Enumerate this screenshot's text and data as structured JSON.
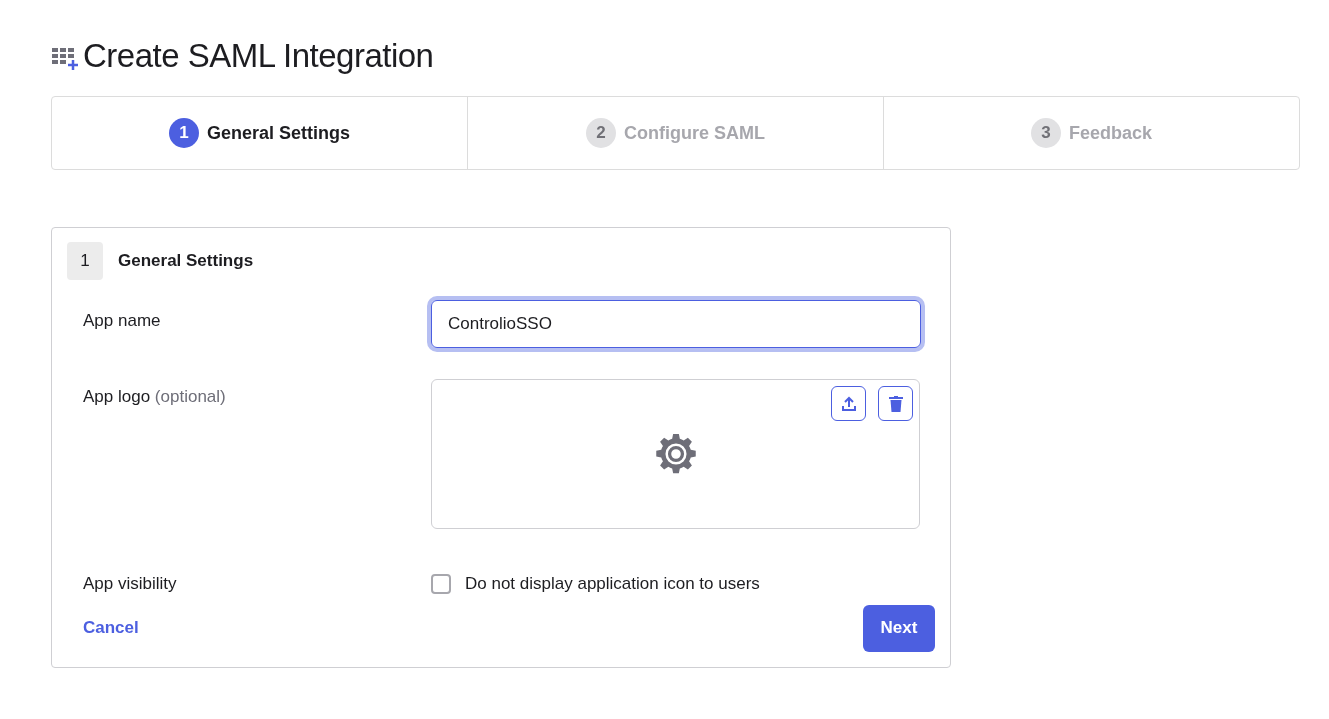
{
  "title": "Create SAML Integration",
  "steps": [
    {
      "number": "1",
      "label": "General Settings",
      "selected": true
    },
    {
      "number": "2",
      "label": "Configure SAML",
      "selected": false
    },
    {
      "number": "3",
      "label": "Feedback",
      "selected": false
    }
  ],
  "section": {
    "number": "1",
    "title": "General Settings"
  },
  "app_name": {
    "label": "App name",
    "value": "ControlioSSO",
    "focused": true
  },
  "app_logo": {
    "label": "App logo",
    "hint": "(optional)"
  },
  "app_visibility": {
    "label": "App visibility",
    "checkbox": {
      "label": "Do not display application icon to users",
      "checked": false
    }
  },
  "actions": {
    "cancel": "Cancel",
    "next": "Next"
  }
}
